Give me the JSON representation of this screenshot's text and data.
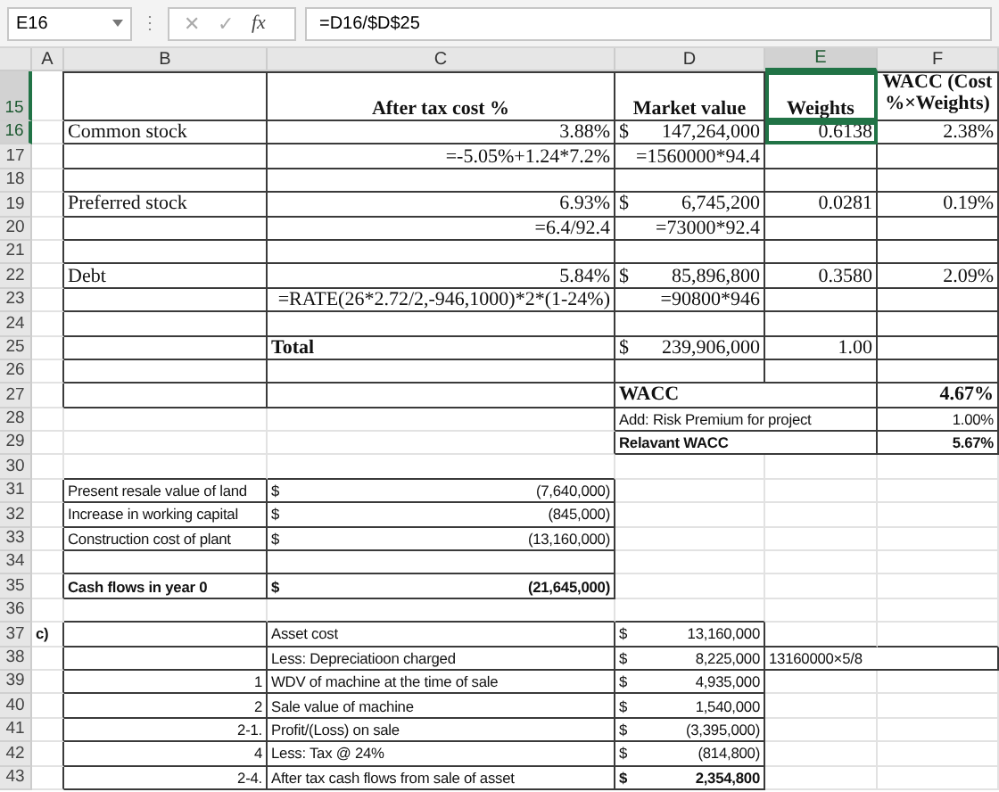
{
  "formula_bar": {
    "name_box": "E16",
    "separator": "⋮",
    "cancel": "✕",
    "enter": "✓",
    "function": "fx",
    "formula": "=D16/$D$25"
  },
  "columns": [
    {
      "label": "A",
      "selected": false
    },
    {
      "label": "B",
      "selected": false
    },
    {
      "label": "C",
      "selected": false
    },
    {
      "label": "D",
      "selected": false
    },
    {
      "label": "E",
      "selected": true
    },
    {
      "label": "F",
      "selected": false
    }
  ],
  "rows": [
    {
      "number": "15",
      "selected": true,
      "kind": "header",
      "cells": {
        "C": {
          "text": "After tax cost %",
          "kind": "center",
          "bold": true
        },
        "D": {
          "text": "Market value",
          "kind": "center",
          "bold": true
        },
        "E": {
          "text": "Weights",
          "kind": "center",
          "bold": true
        },
        "F": {
          "text": "WACC (Cost %×Weights)",
          "kind": "center",
          "bold": true
        }
      }
    },
    {
      "number": "16",
      "selected": true,
      "kind": "wacc",
      "cells": {
        "B": {
          "text": "Common stock",
          "kind": "text"
        },
        "C": {
          "text": "3.88%",
          "kind": "num"
        },
        "D": {
          "prefix": "$",
          "text": "147,264,000",
          "kind": "num"
        },
        "E": {
          "text": "0.6138",
          "kind": "num"
        },
        "F": {
          "text": "2.38%",
          "kind": "num"
        }
      }
    },
    {
      "number": "17",
      "selected": false,
      "kind": "wacc",
      "cells": {
        "C": {
          "text": "=-5.05%+1.24*7.2%",
          "kind": "num"
        },
        "D": {
          "text": "=1560000*94.4",
          "kind": "num"
        }
      }
    },
    {
      "number": "18",
      "selected": false,
      "kind": "wacc",
      "cells": {}
    },
    {
      "number": "19",
      "selected": false,
      "kind": "wacc",
      "cells": {
        "B": {
          "text": "Preferred stock",
          "kind": "text"
        },
        "C": {
          "text": "6.93%",
          "kind": "num"
        },
        "D": {
          "prefix": "$",
          "text": "6,745,200",
          "kind": "num"
        },
        "E": {
          "text": "0.0281",
          "kind": "num"
        },
        "F": {
          "text": "0.19%",
          "kind": "num"
        }
      }
    },
    {
      "number": "20",
      "selected": false,
      "kind": "wacc",
      "cells": {
        "C": {
          "text": "=6.4/92.4",
          "kind": "num"
        },
        "D": {
          "text": "=73000*92.4",
          "kind": "num"
        }
      }
    },
    {
      "number": "21",
      "selected": false,
      "kind": "wacc",
      "cells": {}
    },
    {
      "number": "22",
      "selected": false,
      "kind": "wacc",
      "cells": {
        "B": {
          "text": "Debt",
          "kind": "text"
        },
        "C": {
          "text": "5.84%",
          "kind": "num"
        },
        "D": {
          "prefix": "$",
          "text": "85,896,800",
          "kind": "num"
        },
        "E": {
          "text": "0.3580",
          "kind": "num"
        },
        "F": {
          "text": "2.09%",
          "kind": "num"
        }
      }
    },
    {
      "number": "23",
      "selected": false,
      "kind": "wacc",
      "cells": {
        "C": {
          "text": "=RATE(26*2.72/2,-946,1000)*2*(1-24%)",
          "kind": "num"
        },
        "D": {
          "text": "=90800*946",
          "kind": "num"
        }
      }
    },
    {
      "number": "24",
      "selected": false,
      "kind": "wacc",
      "cells": {}
    },
    {
      "number": "25",
      "selected": false,
      "kind": "wacc",
      "cells": {
        "C": {
          "text": "Total",
          "kind": "text",
          "bold": true
        },
        "D": {
          "prefix": "$",
          "text": "239,906,000",
          "kind": "num"
        },
        "E": {
          "text": "1.00",
          "kind": "num"
        }
      }
    },
    {
      "number": "26",
      "selected": false,
      "kind": "wacc",
      "cells": {}
    },
    {
      "number": "27",
      "selected": false,
      "kind": "wacc",
      "cells": {
        "D": {
          "text": "WACC",
          "kind": "text",
          "bold": true
        },
        "F": {
          "text": "4.67%",
          "kind": "num",
          "bold": true
        }
      }
    },
    {
      "number": "28",
      "selected": false,
      "kind": "premium",
      "cells": {
        "D": {
          "text": "Add: Risk Premium for project",
          "kind": "text"
        },
        "F": {
          "text": "1.00%",
          "kind": "num"
        }
      }
    },
    {
      "number": "29",
      "selected": false,
      "kind": "premium",
      "cells": {
        "D": {
          "text": "Relavant WACC",
          "kind": "text",
          "bold": true
        },
        "F": {
          "text": "5.67%",
          "kind": "num",
          "bold": true
        }
      }
    },
    {
      "number": "30",
      "selected": false,
      "kind": "blank",
      "cells": {}
    },
    {
      "number": "31",
      "selected": false,
      "kind": "cashflow",
      "cells": {
        "B": {
          "text": "Present resale value of land",
          "kind": "text"
        },
        "C": {
          "prefix": "$",
          "text": "(7,640,000)",
          "kind": "num"
        }
      }
    },
    {
      "number": "32",
      "selected": false,
      "kind": "cashflow",
      "cells": {
        "B": {
          "text": "Increase in working capital",
          "kind": "text"
        },
        "C": {
          "prefix": "$",
          "text": "(845,000)",
          "kind": "num"
        }
      }
    },
    {
      "number": "33",
      "selected": false,
      "kind": "cashflow",
      "cells": {
        "B": {
          "text": "Construction cost of plant",
          "kind": "text"
        },
        "C": {
          "prefix": "$",
          "text": "(13,160,000)",
          "kind": "num"
        }
      }
    },
    {
      "number": "34",
      "selected": false,
      "kind": "cashflow",
      "cells": {}
    },
    {
      "number": "35",
      "selected": false,
      "kind": "cashflow",
      "cells": {
        "B": {
          "text": "Cash flows in year 0",
          "kind": "text",
          "bold": true
        },
        "C": {
          "prefix": "$",
          "text": "(21,645,000)",
          "kind": "num",
          "bold": true
        }
      }
    },
    {
      "number": "36",
      "selected": false,
      "kind": "blank",
      "cells": {}
    },
    {
      "number": "37",
      "selected": false,
      "kind": "asset",
      "cells": {
        "A": {
          "text": "c)",
          "bold": true
        },
        "C": {
          "text": "Asset cost",
          "kind": "text"
        },
        "D": {
          "prefix": "$",
          "text": "13,160,000",
          "kind": "num"
        }
      }
    },
    {
      "number": "38",
      "selected": false,
      "kind": "asset_note",
      "cells": {
        "C": {
          "text": "Less: Depreciatioon charged",
          "kind": "text"
        },
        "D": {
          "prefix": "$",
          "text": "8,225,000",
          "kind": "num"
        },
        "E": {
          "text": "13160000×5/8",
          "kind": "text"
        }
      }
    },
    {
      "number": "39",
      "selected": false,
      "kind": "asset",
      "cells": {
        "B": {
          "text": "1",
          "kind": "num"
        },
        "C": {
          "text": "WDV of machine at the time of sale",
          "kind": "text"
        },
        "D": {
          "prefix": "$",
          "text": "4,935,000",
          "kind": "num"
        }
      }
    },
    {
      "number": "40",
      "selected": false,
      "kind": "asset",
      "cells": {
        "B": {
          "text": "2",
          "kind": "num"
        },
        "C": {
          "text": "Sale value of machine",
          "kind": "text"
        },
        "D": {
          "prefix": "$",
          "text": "1,540,000",
          "kind": "num"
        }
      }
    },
    {
      "number": "41",
      "selected": false,
      "kind": "asset",
      "cells": {
        "B": {
          "text": "2-1.",
          "kind": "num"
        },
        "C": {
          "text": "Profit/(Loss) on sale",
          "kind": "text"
        },
        "D": {
          "prefix": "$",
          "text": "(3,395,000)",
          "kind": "num"
        }
      }
    },
    {
      "number": "42",
      "selected": false,
      "kind": "asset",
      "cells": {
        "B": {
          "text": "4",
          "kind": "num"
        },
        "C": {
          "text": "Less: Tax @ 24%",
          "kind": "text"
        },
        "D": {
          "prefix": "$",
          "text": "(814,800)",
          "kind": "num"
        }
      }
    },
    {
      "number": "43",
      "selected": false,
      "kind": "asset",
      "cells": {
        "B": {
          "text": "2-4.",
          "kind": "num"
        },
        "C": {
          "text": "After tax cash flows from sale of asset",
          "kind": "text"
        },
        "D": {
          "prefix": "$",
          "text": "2,354,800",
          "kind": "num",
          "bold": true
        }
      }
    }
  ]
}
